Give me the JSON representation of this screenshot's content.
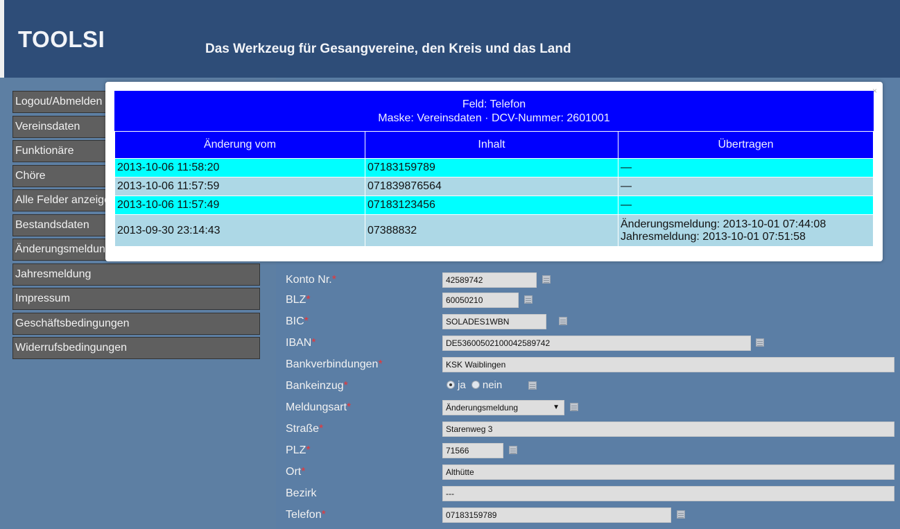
{
  "header": {
    "title": "TOOLSI",
    "subtitle": "Das Werkzeug für Gesangvereine, den Kreis und das Land"
  },
  "sidebar": {
    "items": [
      {
        "label": "Logout/Abmelden"
      },
      {
        "label": "Vereinsdaten"
      },
      {
        "label": "Funktionäre"
      },
      {
        "label": "Chöre"
      },
      {
        "label": "Alle Felder anzeigen"
      },
      {
        "label": "Bestandsdaten"
      },
      {
        "label": "Änderungsmeldung"
      },
      {
        "label": "Jahresmeldung"
      },
      {
        "label": "Impressum"
      },
      {
        "label": "Geschäftsbedingungen"
      },
      {
        "label": "Widerrufsbedingungen"
      }
    ]
  },
  "form": {
    "konto": {
      "label": "Konto Nr.",
      "value": "42589742"
    },
    "blz": {
      "label": "BLZ",
      "value": "60050210"
    },
    "bic": {
      "label": "BIC",
      "value": "SOLADES1WBN"
    },
    "iban": {
      "label": "IBAN",
      "value": "DE53600502100042589742"
    },
    "bank": {
      "label": "Bankverbindungen",
      "value": "KSK Waiblingen"
    },
    "bankeinzug": {
      "label": "Bankeinzug",
      "opt_yes": "ja",
      "opt_no": "nein"
    },
    "meldungsart": {
      "label": "Meldungsart",
      "value": "Änderungsmeldung"
    },
    "strasse": {
      "label": "Straße",
      "value": "Starenweg 3"
    },
    "plz": {
      "label": "PLZ",
      "value": "71566"
    },
    "ort": {
      "label": "Ort",
      "value": "Althütte"
    },
    "bezirk": {
      "label": "Bezirk",
      "value": "---"
    },
    "telefon": {
      "label": "Telefon",
      "value": "07183159789"
    },
    "required_mark": "*"
  },
  "modal": {
    "close": "×",
    "title_line1": "Feld: Telefon",
    "title_line2": "Maske: Vereinsdaten · DCV-Nummer: 2601001",
    "columns": [
      "Änderung vom",
      "Inhalt",
      "Übertragen"
    ],
    "rows": [
      {
        "date": "2013-10-06 11:58:20",
        "value": "07183159789",
        "sent1": "—",
        "sent2": ""
      },
      {
        "date": "2013-10-06 11:57:59",
        "value": "071839876564",
        "sent1": "—",
        "sent2": ""
      },
      {
        "date": "2013-10-06 11:57:49",
        "value": "07183123456",
        "sent1": "—",
        "sent2": ""
      },
      {
        "date": "2013-09-30 23:14:43",
        "value": "07388832",
        "sent1": "Änderungsmeldung: 2013-10-01 07:44:08",
        "sent2": "Jahresmeldung: 2013-10-01 07:51:58"
      }
    ]
  },
  "colors": {
    "header_bg": "#2e4d78",
    "content_bg": "#5d7fa3",
    "modal_header": "#0000ff",
    "row_highlight": "#00ffff",
    "row_normal": "#add8e6",
    "required": "#ee3333"
  }
}
